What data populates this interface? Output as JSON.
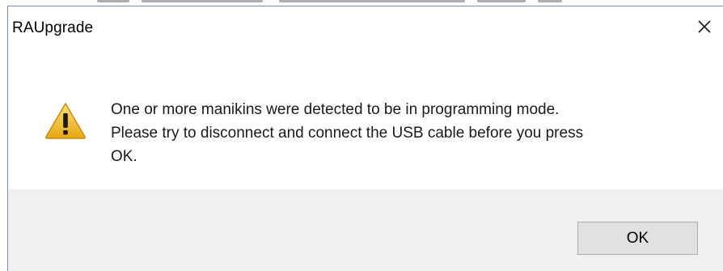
{
  "dialog": {
    "title": "RAUpgrade",
    "close_glyph": "✕",
    "message": "One or more manikins were detected to be in programming mode.\nPlease try to disconnect and connect the USB cable before you press\nOK.",
    "icon": "warning-icon",
    "ok_label": "OK"
  },
  "colors": {
    "window_border": "#6f8fc9",
    "footer_bg": "#f0f0f0",
    "button_bg": "#e1e1e1",
    "warning_fill": "#f5c518"
  }
}
